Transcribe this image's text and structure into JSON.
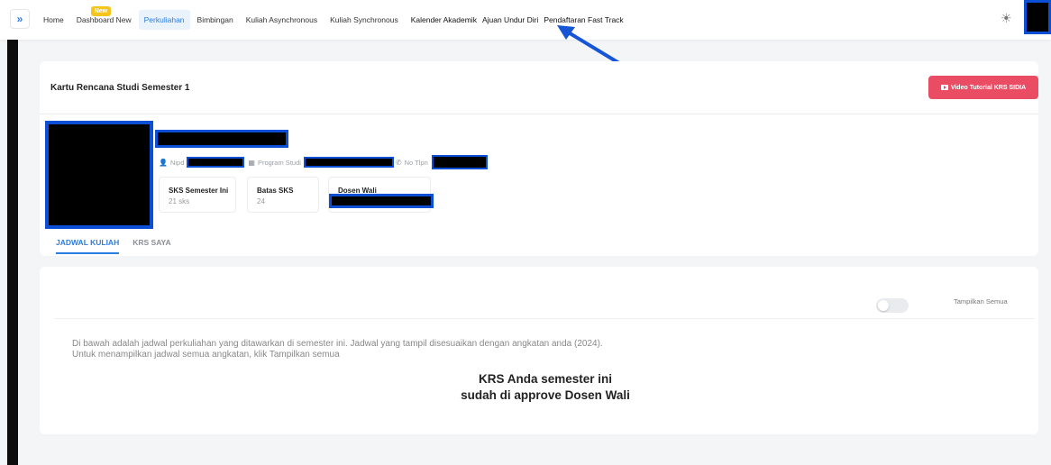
{
  "nav": {
    "items": [
      {
        "label": "Home",
        "active": false
      },
      {
        "label": "Dashboard New",
        "active": false,
        "badge": "New"
      },
      {
        "label": "Perkuliahan",
        "active": true
      },
      {
        "label": "Bimbingan",
        "active": false
      },
      {
        "label": "Kuliah Asynchronous",
        "active": false
      },
      {
        "label": "Kuliah Synchronous",
        "active": false
      },
      {
        "label": "Kalender Akademik",
        "active": false
      },
      {
        "label": "Ajuan Undur Diri",
        "active": false
      },
      {
        "label": "Pendaftaran Fast Track",
        "active": false
      }
    ],
    "toggle_icon": "double-chevron-right-icon",
    "theme_icon": "sun-icon"
  },
  "krs": {
    "title": "Kartu Rencana Studi Semester 1",
    "video_button": "Video Tutorial KRS SIDIA",
    "info": {
      "nipd_label": "Nipd",
      "prodi_label": "Program Studi",
      "tlpn_label": "No Tlpn"
    },
    "stats": [
      {
        "label": "SKS Semester Ini",
        "value": "21 sks"
      },
      {
        "label": "Batas SKS",
        "value": "24"
      },
      {
        "label": "Dosen Wali",
        "value": ""
      }
    ],
    "tabs": [
      {
        "label": "JADWAL KULIAH",
        "active": true
      },
      {
        "label": "KRS SAYA",
        "active": false
      }
    ]
  },
  "schedule": {
    "toggle_label": "Tampilkan Semua",
    "toggle_on": false,
    "description_line1": "Di bawah adalah jadwal perkuliahan yang ditawarkan di semester ini. Jadwal yang tampil disesuaikan dengan angkatan anda (2024).",
    "description_line2": "Untuk menampilkan jadwal semua angkatan, klik Tampilkan semua",
    "approval_line1": "KRS Anda semester ini",
    "approval_line2": "sudah di approve Dosen Wali"
  },
  "colors": {
    "accent": "#2a7de1",
    "video_button": "#ea4c64",
    "badge": "#f6c51c",
    "redaction_border": "#0a4fd6"
  }
}
